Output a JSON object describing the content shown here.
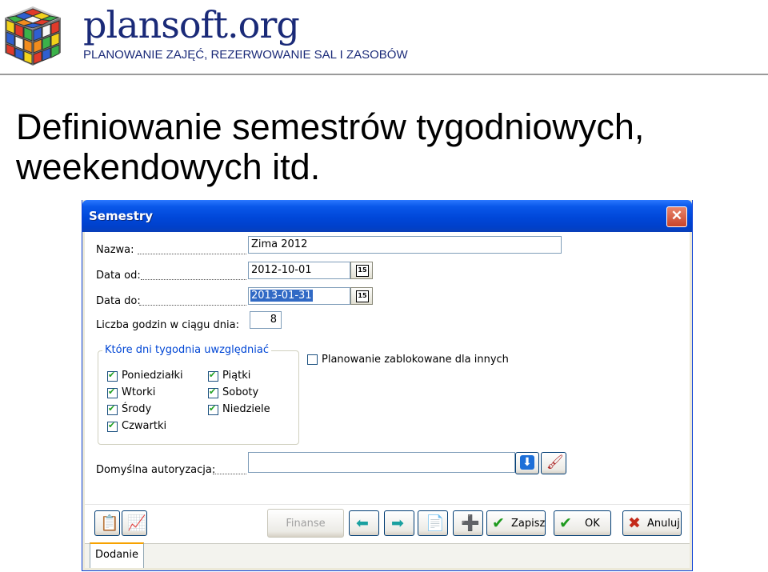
{
  "header": {
    "brand": "plansoft.org",
    "tagline": "PLANOWANIE ZAJĘĆ, REZERWOWANIE SAL I ZASOBÓW"
  },
  "slide": {
    "title": "Definiowanie semestrów tygodniowych, weekendowych itd."
  },
  "window": {
    "title": "Semestry",
    "close_icon": "close-icon"
  },
  "form": {
    "name": {
      "label": "Nazwa:",
      "value": "Zima 2012"
    },
    "date_from": {
      "label": "Data od:",
      "value": "2012-10-01"
    },
    "date_to": {
      "label": "Data do:",
      "value": "2013-01-31"
    },
    "hours": {
      "label": "Liczba godzin w ciągu dnia:",
      "value": "8"
    },
    "calendar_icon_text": "15",
    "days_group": {
      "legend": "Które dni tygodnia uwzględniać",
      "days": [
        {
          "label": "Poniedziałki",
          "checked": true
        },
        {
          "label": "Wtorki",
          "checked": true
        },
        {
          "label": "Środy",
          "checked": true
        },
        {
          "label": "Czwartki",
          "checked": true
        },
        {
          "label": "Piątki",
          "checked": true
        },
        {
          "label": "Soboty",
          "checked": true
        },
        {
          "label": "Niedziele",
          "checked": true
        }
      ]
    },
    "lock_planning": {
      "label": "Planowanie zablokowane dla innych",
      "checked": false
    },
    "default_auth": {
      "label": "Domyślna autoryzacja:",
      "value": ""
    }
  },
  "toolbar": {
    "finanse": "Finanse",
    "zapisz": "Zapisz",
    "ok": "OK",
    "anuluj": "Anuluj"
  },
  "tabs": {
    "active": "Dodanie"
  },
  "colors": {
    "titlebar": "#0047d9",
    "accent": "#1a2a78",
    "check": "#21a121"
  }
}
